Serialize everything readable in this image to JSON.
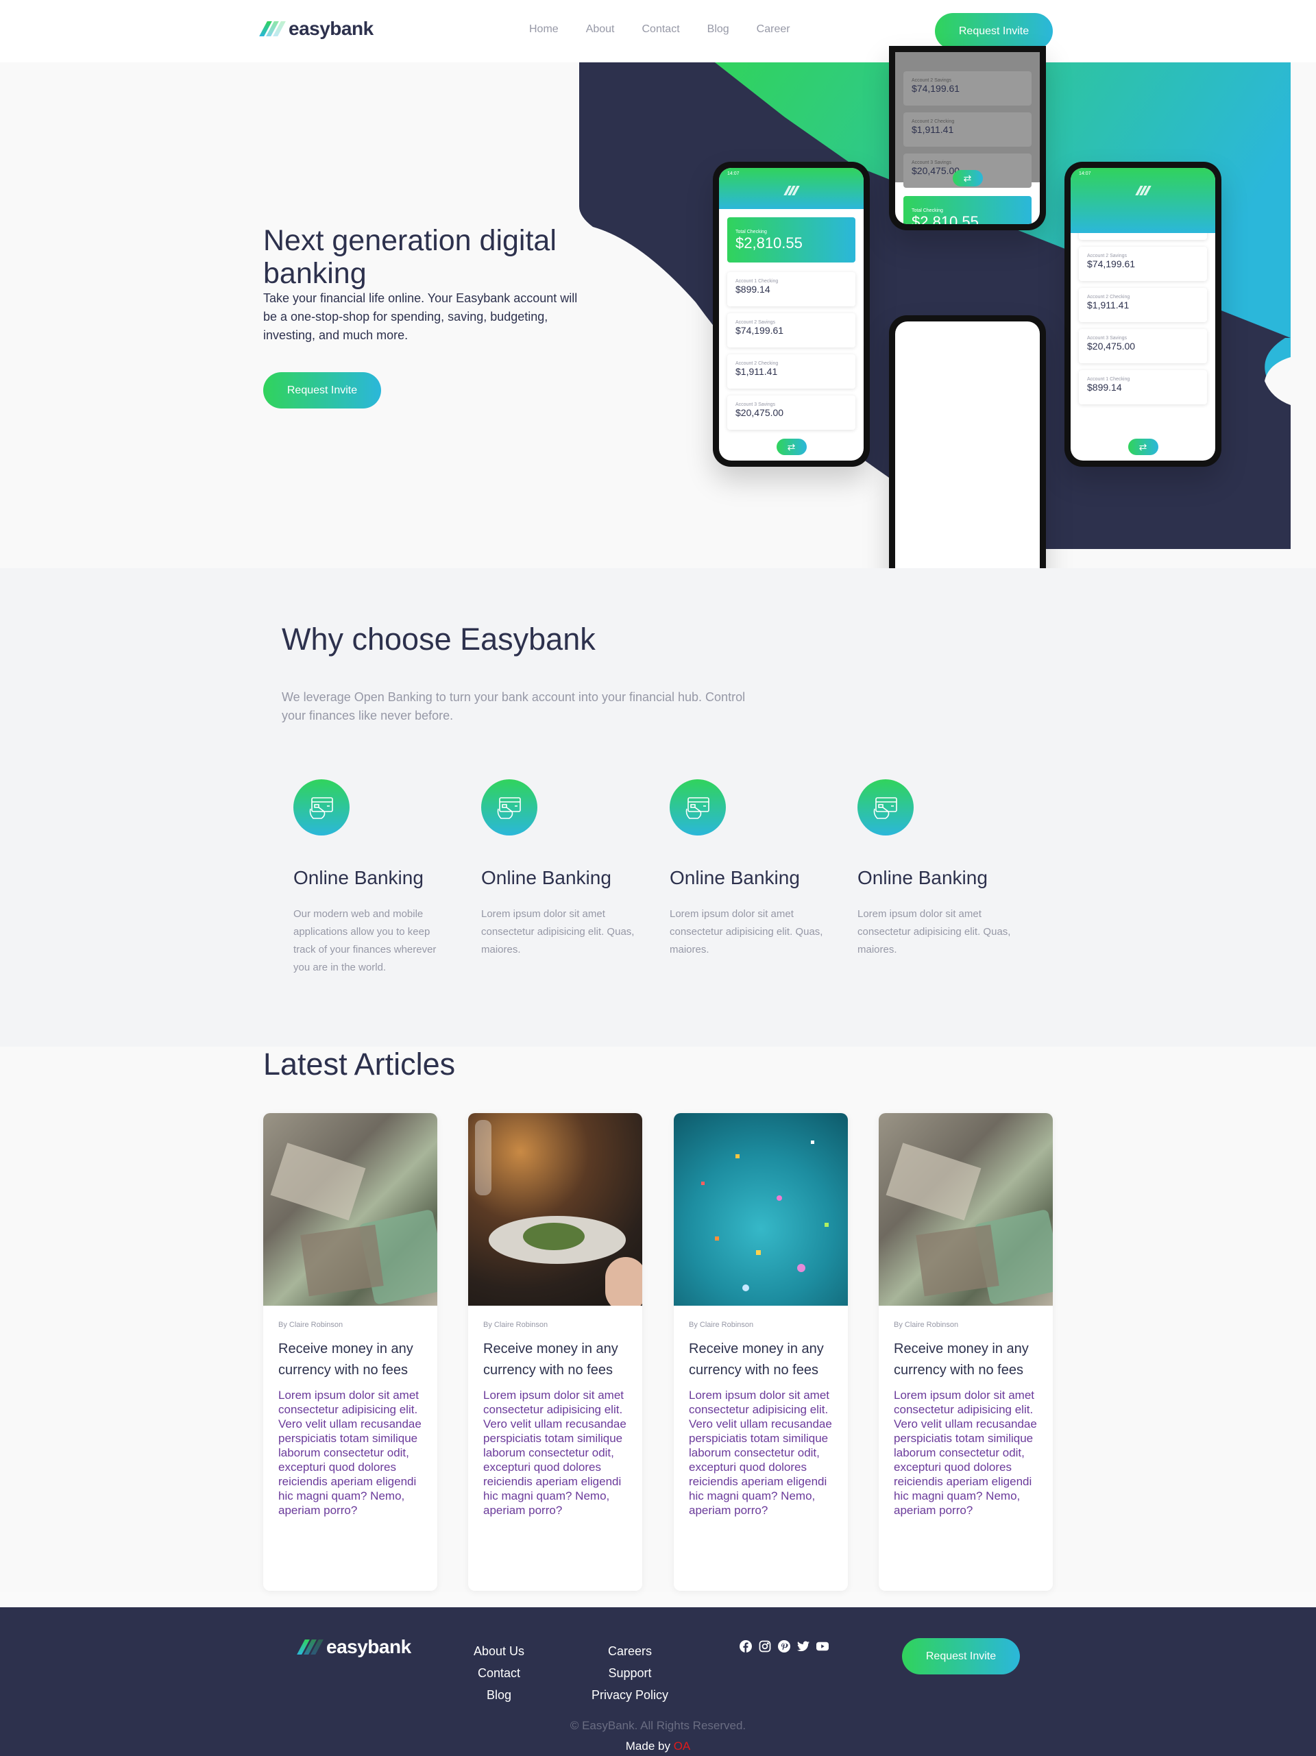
{
  "brand": {
    "name": "easybank"
  },
  "nav": {
    "items": [
      "Home",
      "About",
      "Contact",
      "Blog",
      "Career"
    ]
  },
  "header": {
    "cta": "Request Invite"
  },
  "hero": {
    "title": "Next generation digital banking",
    "description": "Take your financial life online. Your Easybank account will be a one-stop-shop for spending, saving, budgeting, investing, and much more.",
    "cta": "Request Invite"
  },
  "phones": {
    "time": "14:07",
    "total_label": "Total Checking",
    "total_value": "$2,810.55",
    "accounts": [
      {
        "label": "Account 1 Checking",
        "value": "$899.14"
      },
      {
        "label": "Account 2 Savings",
        "value": "$74,199.61"
      },
      {
        "label": "Account 2 Checking",
        "value": "$1,911.41"
      },
      {
        "label": "Account 3 Savings",
        "value": "$20,475.00"
      },
      {
        "label": "Account 1 Checking",
        "value": "$899.14"
      }
    ]
  },
  "why": {
    "title": "Why choose Easybank",
    "description": "We leverage Open Banking to turn your bank account into your financial hub. Control your finances like never before.",
    "features": [
      {
        "icon": "online-banking-icon",
        "title": "Online Banking",
        "text": "Our modern web and mobile applications allow you to keep track of your finances wherever you are in the world."
      },
      {
        "icon": "online-banking-icon",
        "title": "Online Banking",
        "text": "Lorem ipsum dolor sit amet consectetur adipisicing elit. Quas, maiores."
      },
      {
        "icon": "online-banking-icon",
        "title": "Online Banking",
        "text": "Lorem ipsum dolor sit amet consectetur adipisicing elit. Quas, maiores."
      },
      {
        "icon": "online-banking-icon",
        "title": "Online Banking",
        "text": "Lorem ipsum dolor sit amet consectetur adipisicing elit. Quas, maiores."
      }
    ]
  },
  "articles": {
    "title": "Latest Articles",
    "items": [
      {
        "image": "money-photo",
        "author": "By Claire Robinson",
        "title": "Receive money in any currency with no fees",
        "text": "Lorem ipsum dolor sit amet consectetur adipisicing elit. Vero velit ullam recusandae perspiciatis totam similique laborum consectetur odit, excepturi quod dolores reiciendis aperiam eligendi hic magni quam? Nemo, aperiam porro?"
      },
      {
        "image": "restaurant-photo",
        "author": "By Claire Robinson",
        "title": "Receive money in any currency with no fees",
        "text": "Lorem ipsum dolor sit amet consectetur adipisicing elit. Vero velit ullam recusandae perspiciatis totam similique laborum consectetur odit, excepturi quod dolores reiciendis aperiam eligendi hic magni quam? Nemo, aperiam porro?"
      },
      {
        "image": "confetti-photo",
        "author": "By Claire Robinson",
        "title": "Receive money in any currency with no fees",
        "text": "Lorem ipsum dolor sit amet consectetur adipisicing elit. Vero velit ullam recusandae perspiciatis totam similique laborum consectetur odit, excepturi quod dolores reiciendis aperiam eligendi hic magni quam? Nemo, aperiam porro?"
      },
      {
        "image": "money-photo",
        "author": "By Claire Robinson",
        "title": "Receive money in any currency with no fees",
        "text": "Lorem ipsum dolor sit amet consectetur adipisicing elit. Vero velit ullam recusandae perspiciatis totam similique laborum consectetur odit, excepturi quod dolores reiciendis aperiam eligendi hic magni quam? Nemo, aperiam porro?"
      }
    ]
  },
  "footer": {
    "col1": [
      "About Us",
      "Contact",
      "Blog"
    ],
    "col2": [
      "Careers",
      "Support",
      "Privacy Policy"
    ],
    "social": [
      "facebook-icon",
      "instagram-icon",
      "pinterest-icon",
      "twitter-icon",
      "youtube-icon"
    ],
    "cta": "Request Invite",
    "copyright": "© EasyBank. All Rights Reserved.",
    "made_by_label": "Made by",
    "made_by_name": "OA"
  },
  "colors": {
    "dark_blue": "#2d314d",
    "lime_green": "#31d35c",
    "bright_cyan": "#2bb7da",
    "grayish_blue": "#9698a6",
    "article_text": "#6a3a9a",
    "made_by_accent": "#e01b1b"
  }
}
